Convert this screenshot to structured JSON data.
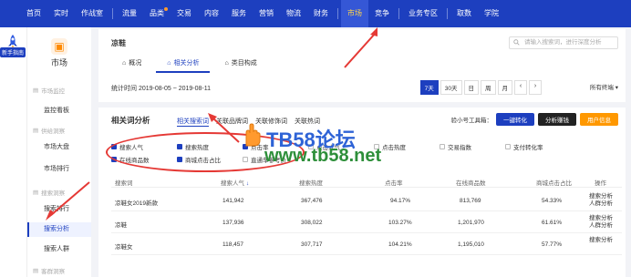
{
  "topnav": {
    "items": [
      "首页",
      "实时",
      "作战室",
      "流量",
      "品类",
      "交易",
      "内容",
      "服务",
      "营销",
      "物流",
      "财务",
      "市场",
      "竞争",
      "业务专区",
      "取数",
      "学院"
    ],
    "active_index": 11
  },
  "sidebar": {
    "new_help": "新手指南",
    "title": "市场",
    "groups": [
      {
        "label": "市场监控",
        "items": [
          "监控看板"
        ]
      },
      {
        "label": "供给洞察",
        "items": [
          "市场大盘",
          "市场排行"
        ]
      },
      {
        "label": "搜索洞察",
        "items": [
          "搜索排行",
          "搜索分析",
          "搜索人群"
        ]
      },
      {
        "label": "客群洞察",
        "items": []
      }
    ],
    "active_item": "搜索分析"
  },
  "panel1": {
    "keyword": "凉鞋",
    "search_placeholder": "请输入搜索词，进行深度分析",
    "tabs": [
      "概况",
      "相关分析",
      "类目构成"
    ],
    "active_tab": 1,
    "stat_time": "统计时间 2019-08-05 ~ 2019-08-11",
    "date_buttons": [
      "7天",
      "30天",
      "日",
      "周",
      "月"
    ],
    "active_date": 0,
    "terminal": "所有终端"
  },
  "panel2": {
    "title": "相关词分析",
    "subtabs": [
      "相关搜索词",
      "关联品牌词",
      "关联修饰词",
      "关联热词"
    ],
    "active_subtab": 0,
    "tool_label": "验小号工具箱：",
    "tool_buttons": [
      {
        "label": "一键转化",
        "color": "#1d3fbf"
      },
      {
        "label": "分析赚钱",
        "color": "#222222"
      },
      {
        "label": "用户信息",
        "color": "#ff9800"
      }
    ],
    "checkboxes": [
      {
        "label": "搜索人气",
        "checked": true
      },
      {
        "label": "搜索热度",
        "checked": true
      },
      {
        "label": "点击率",
        "checked": true
      },
      {
        "label": "点击人气",
        "checked": false
      },
      {
        "label": "点击热度",
        "checked": false
      },
      {
        "label": "交易指数",
        "checked": false
      },
      {
        "label": "支付转化率",
        "checked": false
      },
      {
        "label": "在线商品数",
        "checked": true
      },
      {
        "label": "商城点击占比",
        "checked": true
      },
      {
        "label": "直通车参考价",
        "checked": false
      }
    ],
    "columns": [
      "搜索词",
      "搜索人气",
      "搜索热度",
      "点击率",
      "在线商品数",
      "商城点击占比",
      "操作"
    ],
    "rows": [
      {
        "word": "凉鞋女2019新款",
        "popularity": "141,942",
        "heat": "367,476",
        "ctr": "94.17%",
        "items": "813,769",
        "mall": "54.33%",
        "op1": "搜索分析",
        "op2": "人群分析"
      },
      {
        "word": "凉鞋",
        "popularity": "137,936",
        "heat": "308,022",
        "ctr": "103.27%",
        "items": "1,201,970",
        "mall": "61.61%",
        "op1": "搜索分析",
        "op2": "人群分析"
      },
      {
        "word": "凉鞋女",
        "popularity": "118,457",
        "heat": "307,717",
        "ctr": "104.21%",
        "items": "1,195,010",
        "mall": "57.77%",
        "op1": "搜索分析",
        "op2": ""
      }
    ]
  },
  "watermark": {
    "line1": "TB58论坛",
    "line2": "www.tb58.net"
  }
}
